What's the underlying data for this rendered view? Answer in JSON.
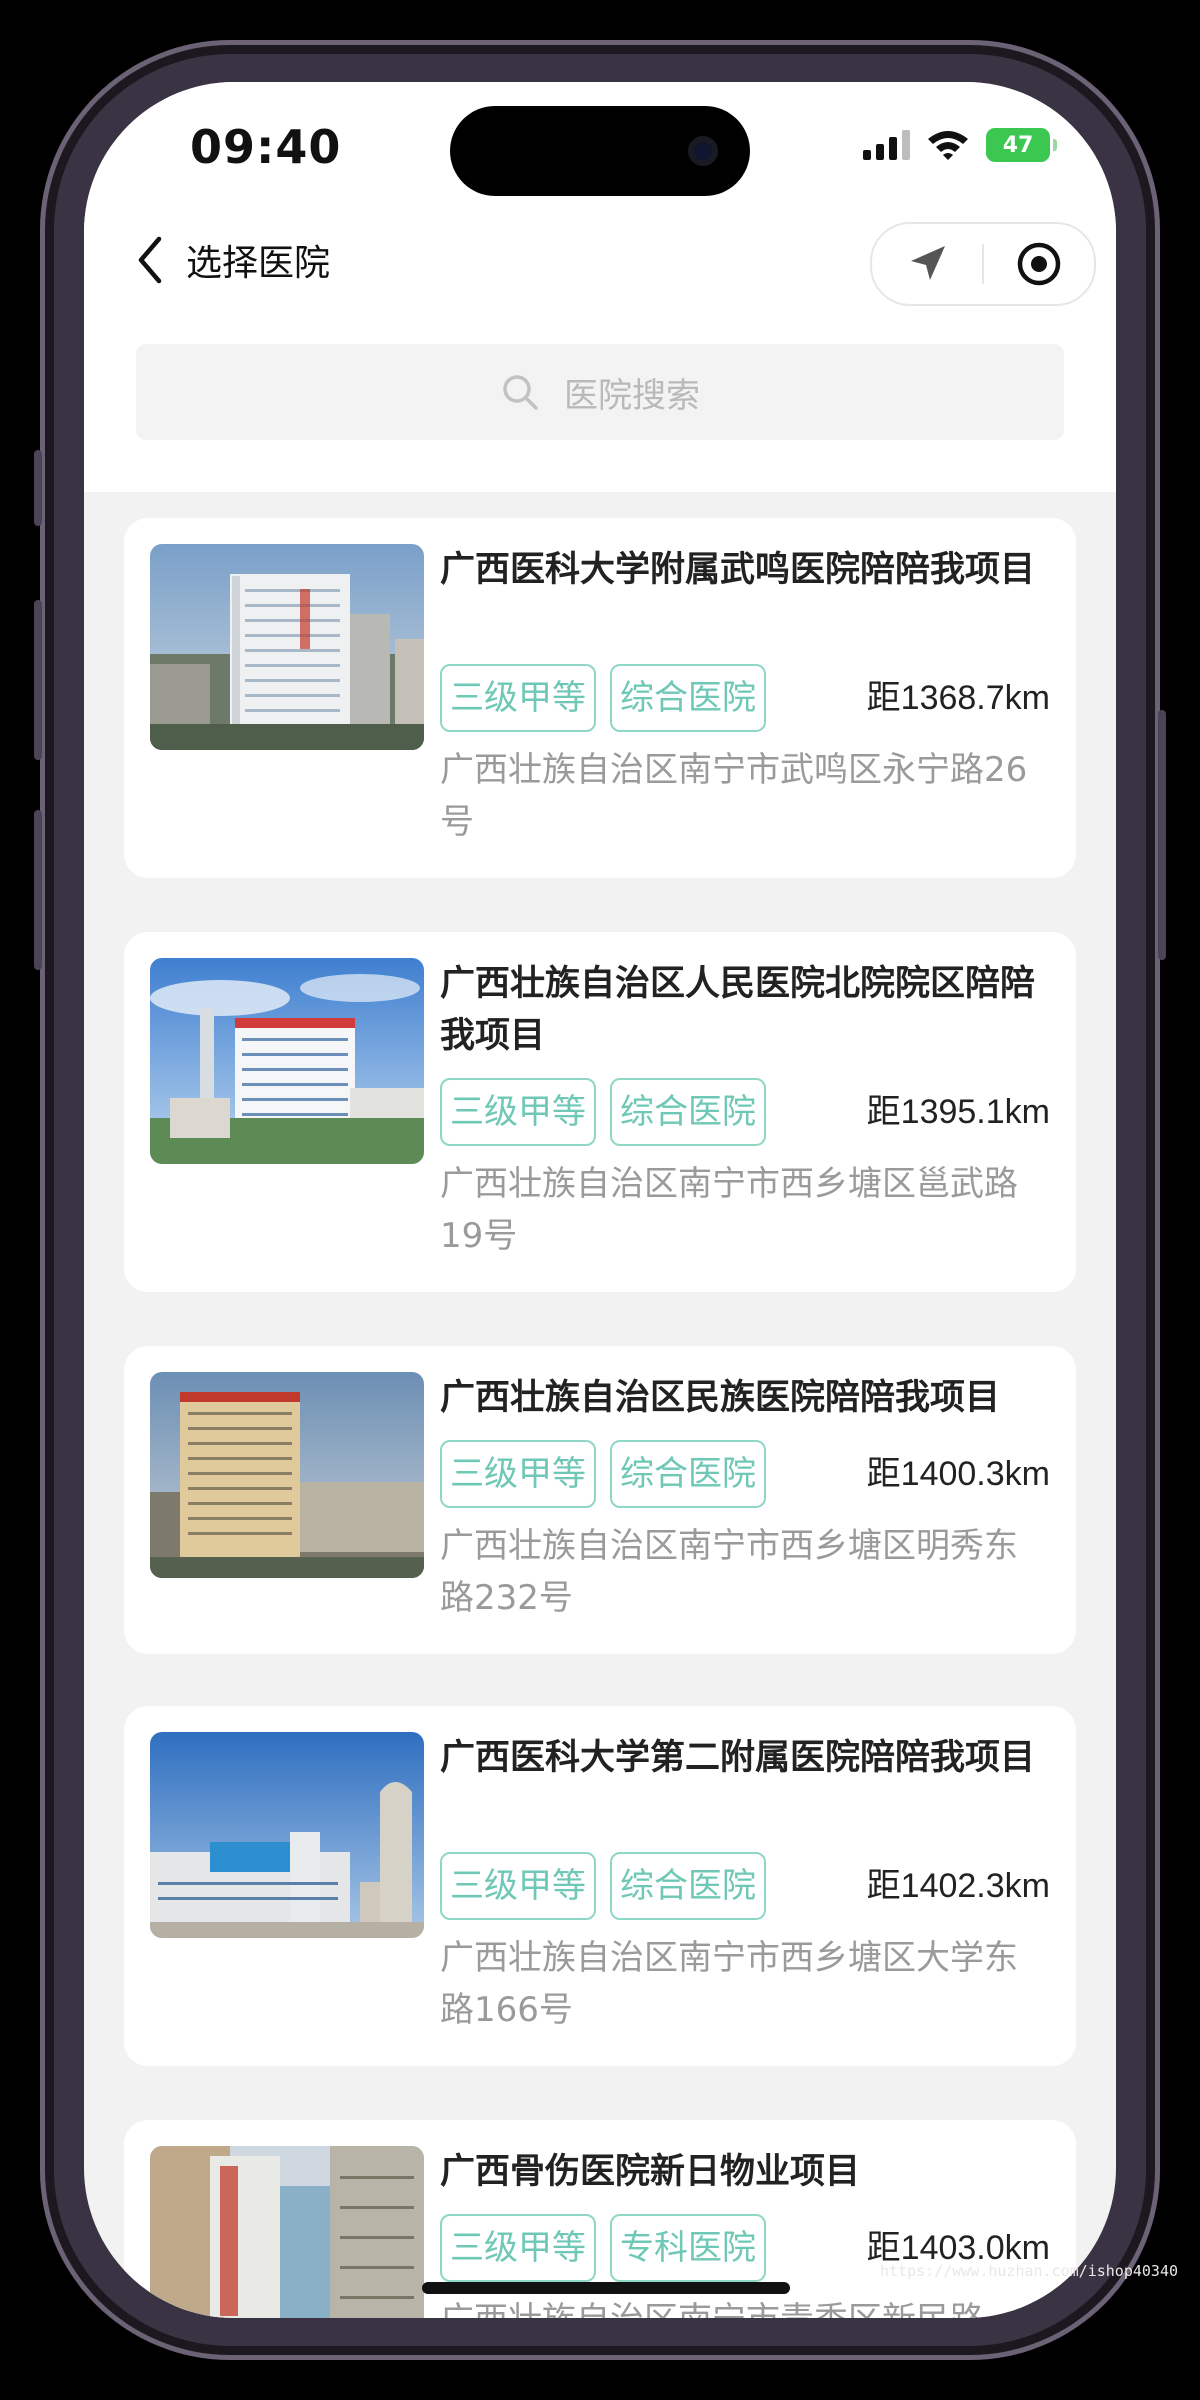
{
  "status_bar": {
    "time": "09:40",
    "battery_level": "47"
  },
  "nav": {
    "back_icon": "chevron-left-icon",
    "title": "选择医院",
    "capsule": {
      "left_icon": "location-arrow-icon",
      "right_icon": "target-circle-icon"
    }
  },
  "search": {
    "placeholder": "医院搜索",
    "icon": "search-icon"
  },
  "theme": {
    "tag_color": "#6fc8b6",
    "tag_border": "#8fd6c7",
    "page_bg": "#f2f2f2"
  },
  "hospitals": [
    {
      "name": "广西医科大学附属武鸣医院陪陪我项目",
      "tags": [
        "三级甲等",
        "综合医院"
      ],
      "distance": "距1368.7km",
      "address": "广西壮族自治区南宁市武鸣区永宁路26号"
    },
    {
      "name": "广西壮族自治区人民医院北院院区陪陪我项目",
      "tags": [
        "三级甲等",
        "综合医院"
      ],
      "distance": "距1395.1km",
      "address": "广西壮族自治区南宁市西乡塘区邕武路19号"
    },
    {
      "name": "广西壮族自治区民族医院陪陪我项目",
      "tags": [
        "三级甲等",
        "综合医院"
      ],
      "distance": "距1400.3km",
      "address": "广西壮族自治区南宁市西乡塘区明秀东路232号"
    },
    {
      "name": "广西医科大学第二附属医院陪陪我项目",
      "tags": [
        "三级甲等",
        "综合医院"
      ],
      "distance": "距1402.3km",
      "address": "广西壮族自治区南宁市西乡塘区大学东路166号"
    },
    {
      "name": "广西骨伤医院新日物业项目",
      "tags": [
        "三级甲等",
        "专科医院"
      ],
      "distance": "距1403.0km",
      "address": "广西壮族自治区南宁市青秀区新民路"
    }
  ],
  "watermark": "https://www.huzhan.com/ishop40340"
}
